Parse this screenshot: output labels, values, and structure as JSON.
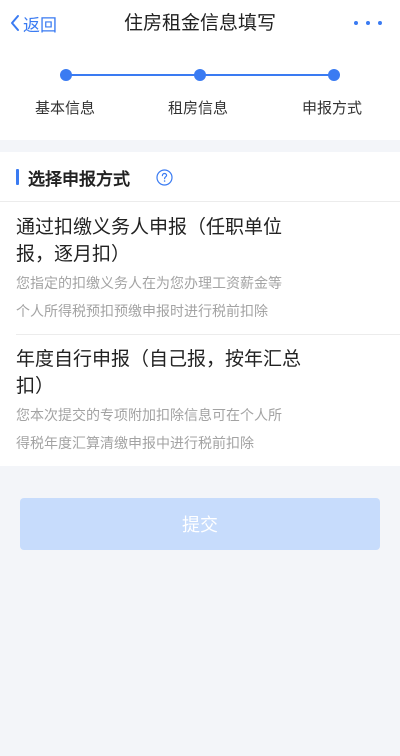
{
  "header": {
    "back_label": "返回",
    "title": "住房租金信息填写",
    "more_icon": "more-dots-icon"
  },
  "steps": [
    {
      "label": "基本信息"
    },
    {
      "label": "租房信息"
    },
    {
      "label": "申报方式"
    }
  ],
  "section": {
    "title": "选择申报方式",
    "help_icon": "question-circle-icon"
  },
  "options": [
    {
      "title_line1": "通过扣缴义务人申报（任职单位",
      "title_line2": "报，逐月扣）",
      "desc_line1": "您指定的扣缴义务人在为您办理工资薪金等",
      "desc_line2": "个人所得税预扣预缴申报时进行税前扣除"
    },
    {
      "title_line1": "年度自行申报（自己报，按年汇总",
      "title_line2": "扣）",
      "desc_line1": "您本次提交的专项附加扣除信息可在个人所",
      "desc_line2": "得税年度汇算清缴申报中进行税前扣除"
    }
  ],
  "submit_label": "提交",
  "colors": {
    "accent": "#3a7bf2",
    "submit_disabled": "#c7dcfc",
    "background": "#f3f5f9"
  }
}
